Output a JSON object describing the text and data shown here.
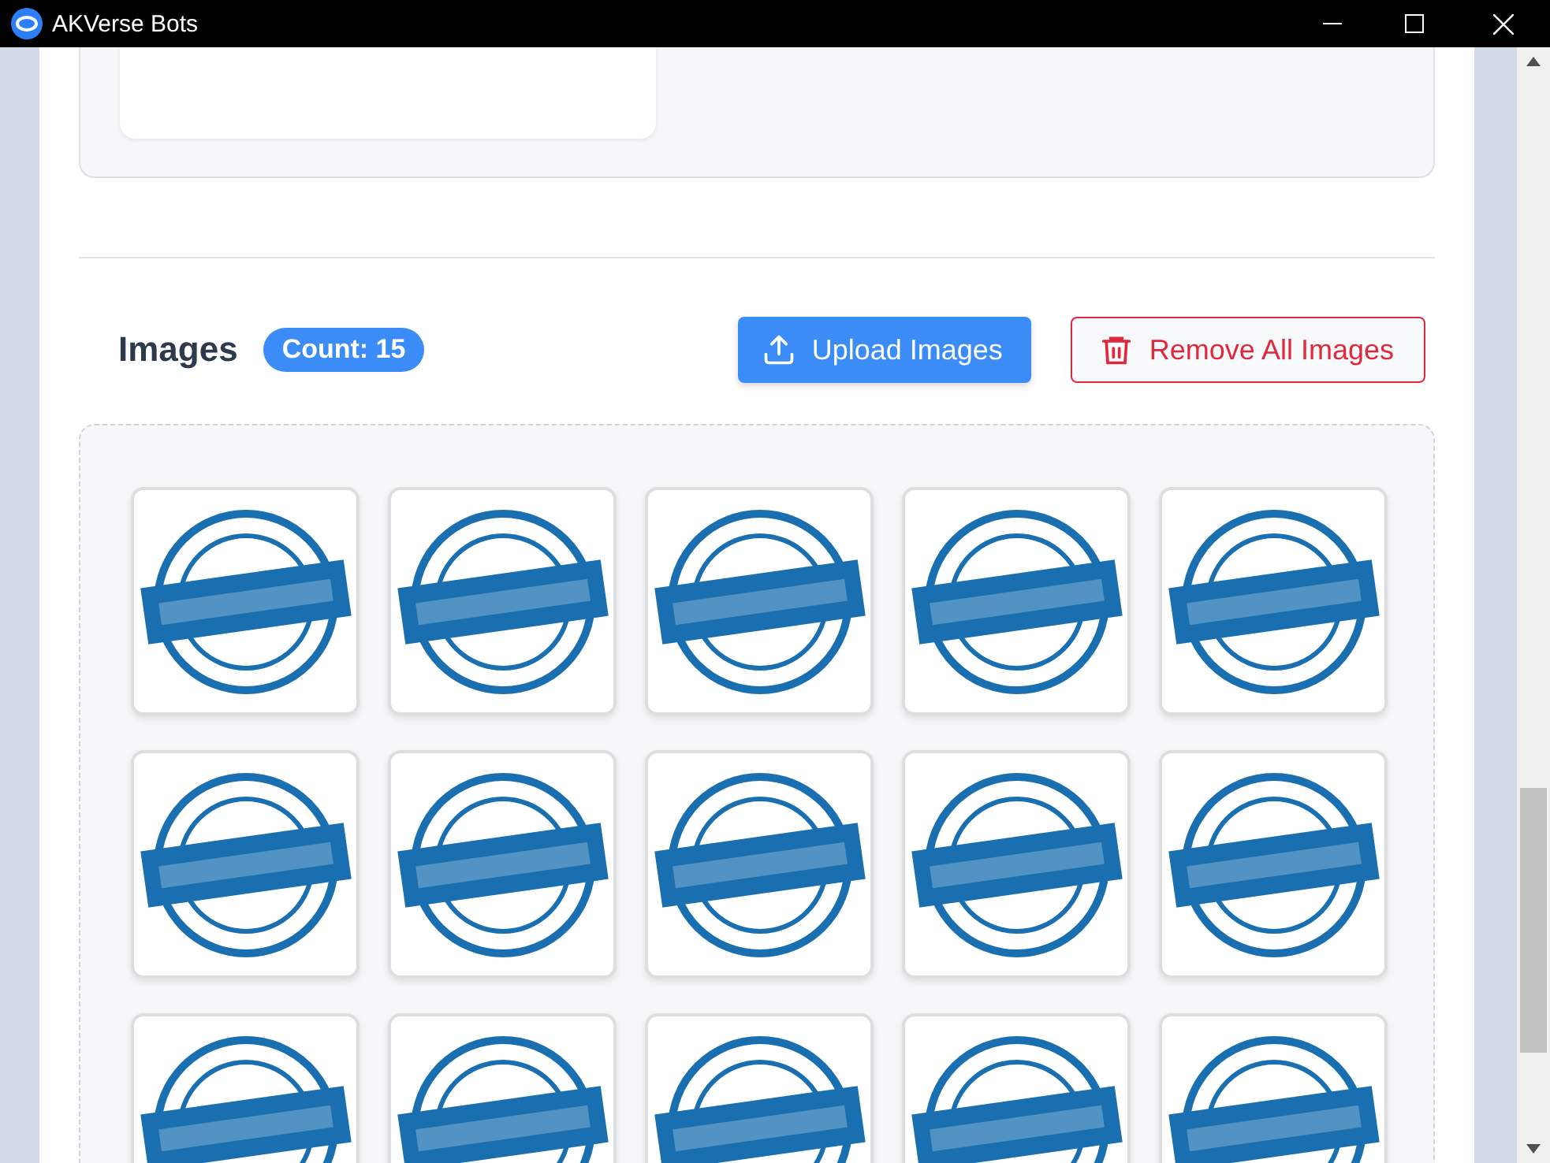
{
  "window": {
    "title": "AKVerse Bots"
  },
  "images_section": {
    "title": "Images",
    "count": "Count: 15",
    "upload_button": "Upload Images",
    "remove_button": "Remove All Images",
    "thumbnails": [
      {
        "kind": "stamp"
      },
      {
        "kind": "stamp"
      },
      {
        "kind": "stamp"
      },
      {
        "kind": "stamp"
      },
      {
        "kind": "stamp"
      },
      {
        "kind": "stamp"
      },
      {
        "kind": "stamp"
      },
      {
        "kind": "stamp"
      },
      {
        "kind": "stamp"
      },
      {
        "kind": "stamp"
      },
      {
        "kind": "stamp"
      },
      {
        "kind": "stamp"
      },
      {
        "kind": "stamp"
      },
      {
        "kind": "stamp"
      },
      {
        "kind": "stamp"
      }
    ]
  }
}
